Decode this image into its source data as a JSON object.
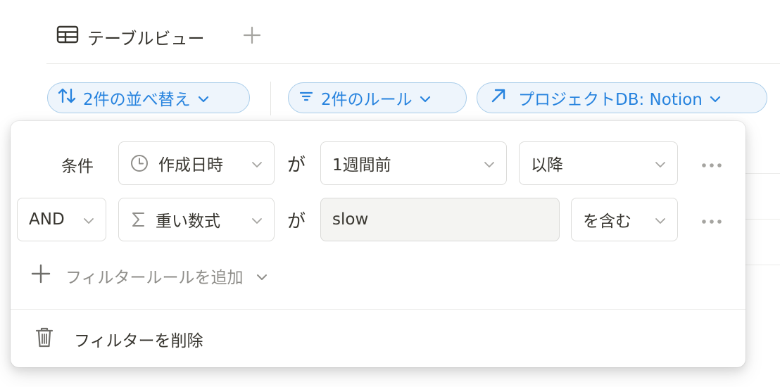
{
  "view": {
    "tab_label": "テーブルビュー"
  },
  "toolbar": {
    "sort_chip": "2件の並べ替え",
    "filter_chip": "2件のルール",
    "source_chip": "プロジェクトDB: Notion"
  },
  "filter_popover": {
    "rows": [
      {
        "label": "条件",
        "property": "作成日時",
        "verb": "が",
        "value": "1週間前",
        "operator": "以降"
      },
      {
        "conjunction": "AND",
        "property": "重い数式",
        "verb": "が",
        "value": "slow",
        "operator": "を含む"
      }
    ],
    "add_rule_label": "フィルタールールを追加",
    "delete_label": "フィルターを削除"
  },
  "icons": {
    "table": "table-icon",
    "plus": "plus-icon",
    "sort": "sort-arrows-icon",
    "filter": "filter-lines-icon",
    "source": "arrow-up-right-icon",
    "clock": "clock-icon",
    "sigma": "sigma-icon",
    "more": "more-horizontal-icon",
    "trash": "trash-icon",
    "chevron": "chevron-down-icon"
  },
  "colors": {
    "accent": "#2783de",
    "chip_bg": "#eef5fc",
    "chip_border": "#a9cdea",
    "text": "#37352f",
    "muted": "#8f8e8a"
  }
}
